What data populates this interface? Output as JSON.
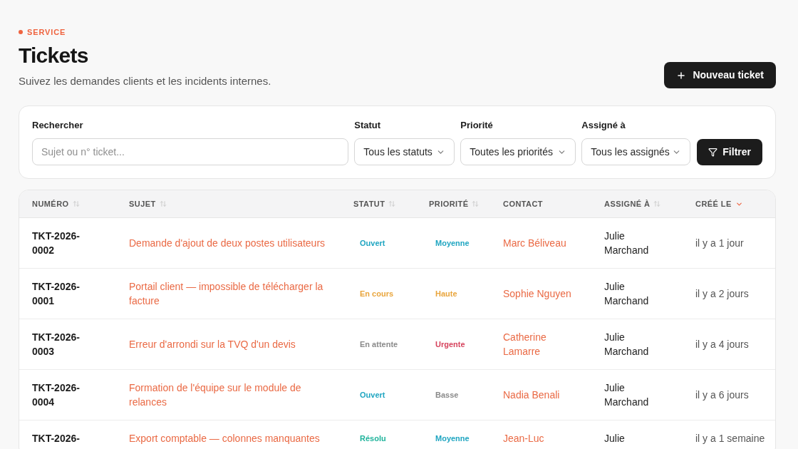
{
  "eyebrow": {
    "label": "SERVICE"
  },
  "page": {
    "title": "Tickets",
    "subtitle": "Suivez les demandes clients et les incidents internes."
  },
  "new_button": {
    "label": "Nouveau ticket"
  },
  "filters": {
    "search": {
      "label": "Rechercher",
      "placeholder": "Sujet ou n° ticket..."
    },
    "selects": [
      {
        "label": "Statut",
        "value": "Tous les statuts"
      },
      {
        "label": "Priorité",
        "value": "Toutes les priorités"
      },
      {
        "label": "Assigné à",
        "value": "Tous les assignés"
      }
    ],
    "submit": {
      "label": "Filtrer"
    }
  },
  "table": {
    "columns": [
      {
        "label": "NUMÉRO",
        "sortable": true,
        "sorted": false
      },
      {
        "label": "SUJET",
        "sortable": true,
        "sorted": false
      },
      {
        "label": "STATUT",
        "sortable": true,
        "sorted": false
      },
      {
        "label": "PRIORITÉ",
        "sortable": true,
        "sorted": false
      },
      {
        "label": "CONTACT",
        "sortable": false,
        "sorted": false
      },
      {
        "label": "ASSIGNÉ À",
        "sortable": true,
        "sorted": false
      },
      {
        "label": "CRÉÉ LE",
        "sortable": true,
        "sorted": true
      }
    ],
    "rows": [
      {
        "number": "TKT-2026-0002",
        "subject": "Demande d'ajout de deux postes utilisateurs",
        "status": {
          "label": "Ouvert",
          "color": "#1fa5c1"
        },
        "priority": {
          "label": "Moyenne",
          "color": "#1fa5c1"
        },
        "contact": "Marc Béliveau",
        "assignee": "Julie Marchand",
        "created": "il y a 1 jour"
      },
      {
        "number": "TKT-2026-0001",
        "subject": "Portail client — impossible de télécharger la facture",
        "status": {
          "label": "En cours",
          "color": "#e9a53c"
        },
        "priority": {
          "label": "Haute",
          "color": "#e9a53c"
        },
        "contact": "Sophie Nguyen",
        "assignee": "Julie Marchand",
        "created": "il y a 2 jours"
      },
      {
        "number": "TKT-2026-0003",
        "subject": "Erreur d'arrondi sur la TVQ d'un devis",
        "status": {
          "label": "En attente",
          "color": "#8a8a8a"
        },
        "priority": {
          "label": "Urgente",
          "color": "#d6435d"
        },
        "contact": "Catherine Lamarre",
        "assignee": "Julie Marchand",
        "created": "il y a 4 jours"
      },
      {
        "number": "TKT-2026-0004",
        "subject": "Formation de l'équipe sur le module de relances",
        "status": {
          "label": "Ouvert",
          "color": "#1fa5c1"
        },
        "priority": {
          "label": "Basse",
          "color": "#8a8a8a"
        },
        "contact": "Nadia Benali",
        "assignee": "Julie Marchand",
        "created": "il y a 6 jours"
      },
      {
        "number": "TKT-2026-",
        "subject": "Export comptable — colonnes manquantes",
        "status": {
          "label": "Résolu",
          "color": "#1fb39b"
        },
        "priority": {
          "label": "Moyenne",
          "color": "#1fa5c1"
        },
        "contact": "Jean-Luc",
        "assignee": "Julie",
        "created": "il y a 1 semaine"
      }
    ]
  }
}
